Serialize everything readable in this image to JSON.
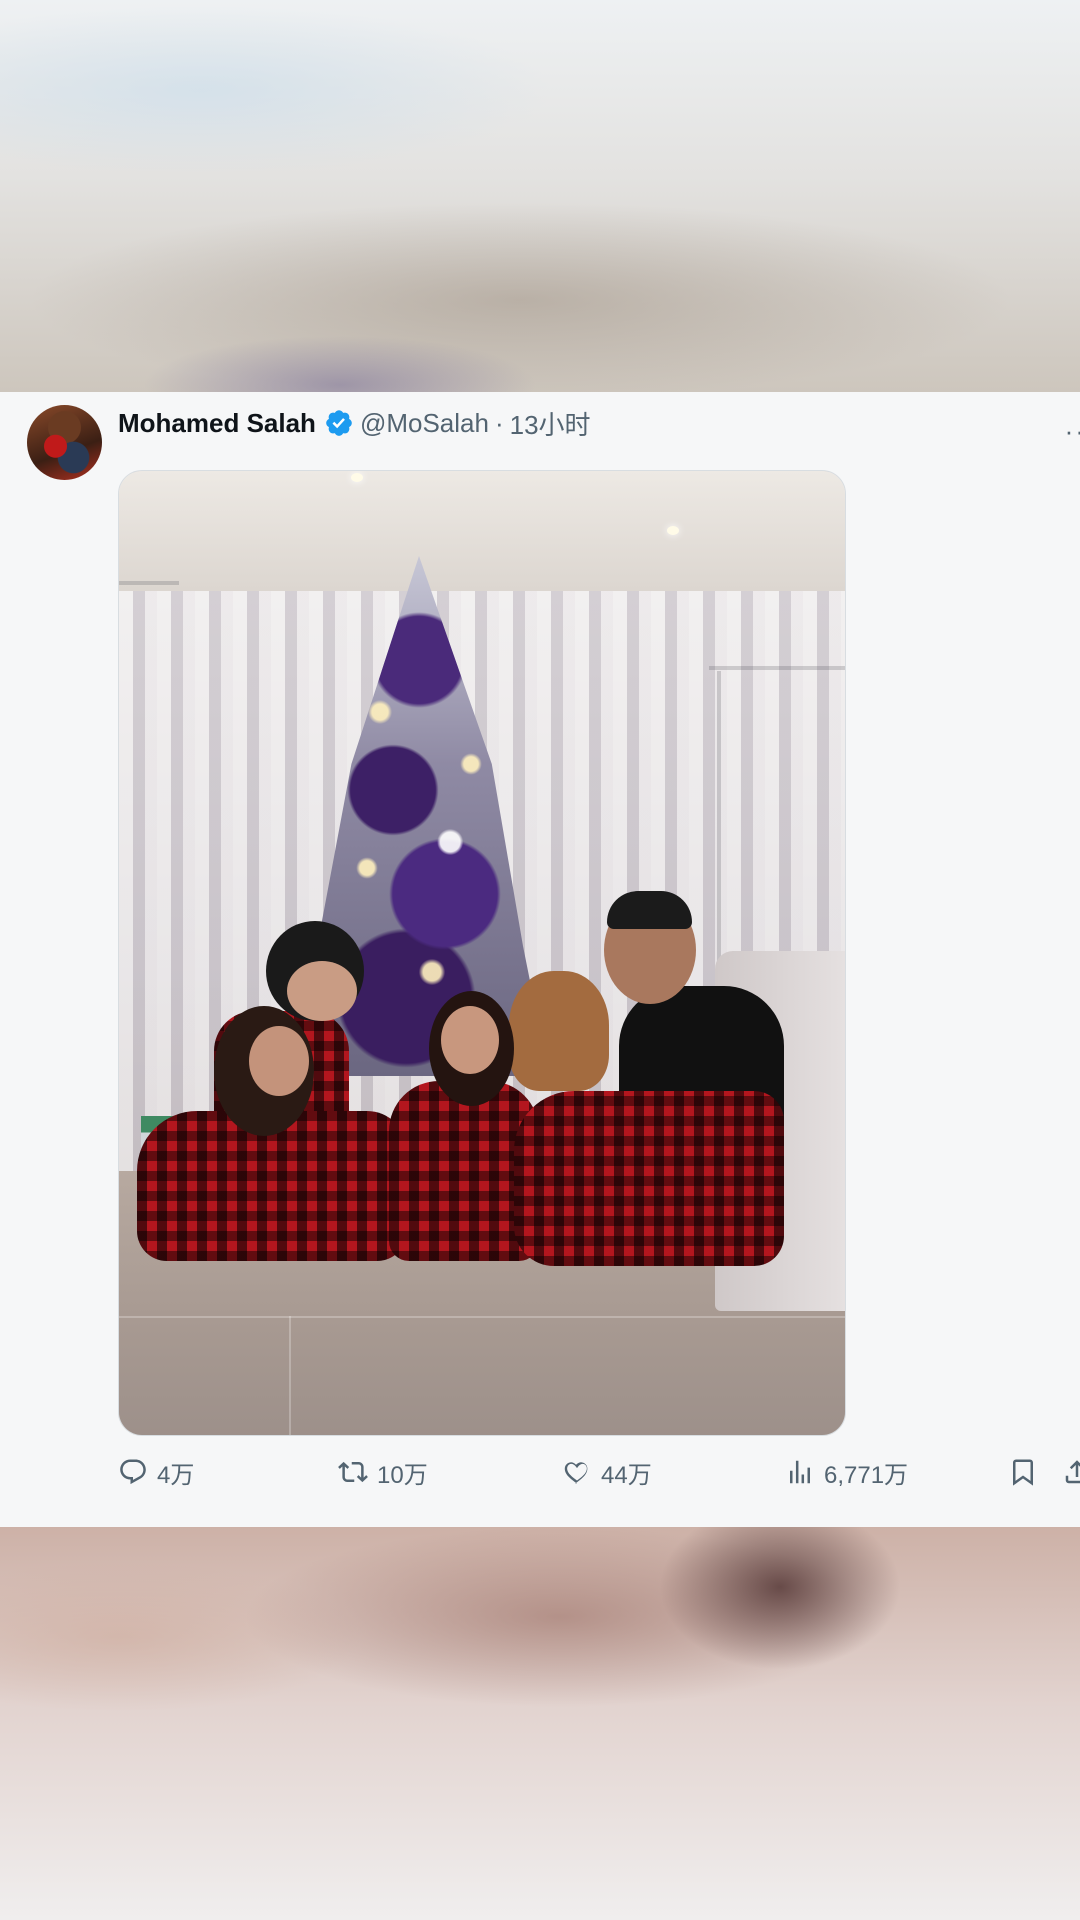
{
  "tweet": {
    "author_name": "Mohamed Salah",
    "handle": "@MoSalah",
    "separator": "·",
    "time": "13小时",
    "more_label": "··",
    "verified": true,
    "image_alt": "Family in matching red plaid pajamas sitting in front of a purple and silver Christmas tree"
  },
  "actions": {
    "replies": "4万",
    "retweets": "10万",
    "likes": "44万",
    "views": "6,771万"
  },
  "colors": {
    "verified_blue": "#1d9bf0",
    "text_primary": "#0f1419",
    "text_secondary": "#536471",
    "card_background": "#f6f7f8"
  },
  "icons": [
    "verified-badge-icon",
    "more-icon",
    "reply-icon",
    "retweet-icon",
    "like-icon",
    "views-icon",
    "bookmark-icon",
    "share-icon"
  ]
}
